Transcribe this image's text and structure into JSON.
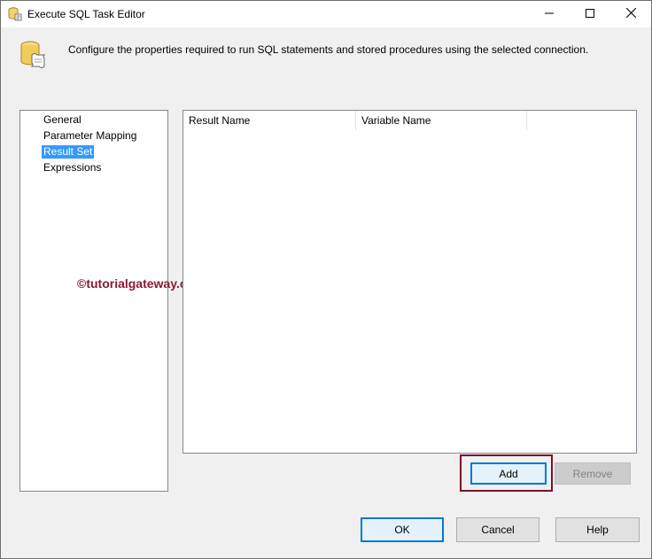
{
  "window": {
    "title": "Execute SQL Task Editor",
    "icon": "sql-task-icon",
    "controls": {
      "minimize_icon": "minimize-icon",
      "maximize_icon": "maximize-icon",
      "close_icon": "close-icon"
    }
  },
  "header": {
    "icon": "database-scroll-icon",
    "description": "Configure the properties required to run SQL statements and stored procedures using the selected connection."
  },
  "nav": {
    "items": [
      {
        "label": "General",
        "selected": false
      },
      {
        "label": "Parameter Mapping",
        "selected": false
      },
      {
        "label": "Result Set",
        "selected": true
      },
      {
        "label": "Expressions",
        "selected": false
      }
    ]
  },
  "result_grid": {
    "columns": [
      "Result Name",
      "Variable Name",
      ""
    ],
    "rows": []
  },
  "grid_buttons": {
    "add_label": "Add",
    "remove_label": "Remove"
  },
  "footer_buttons": {
    "ok_label": "OK",
    "cancel_label": "Cancel",
    "help_label": "Help"
  },
  "watermark": "©tutorialgateway.org",
  "colors": {
    "selection": "#3399ff",
    "default_button_border": "#0078d7",
    "highlight_box": "#7a0f2a",
    "watermark": "#8b1a2f"
  }
}
